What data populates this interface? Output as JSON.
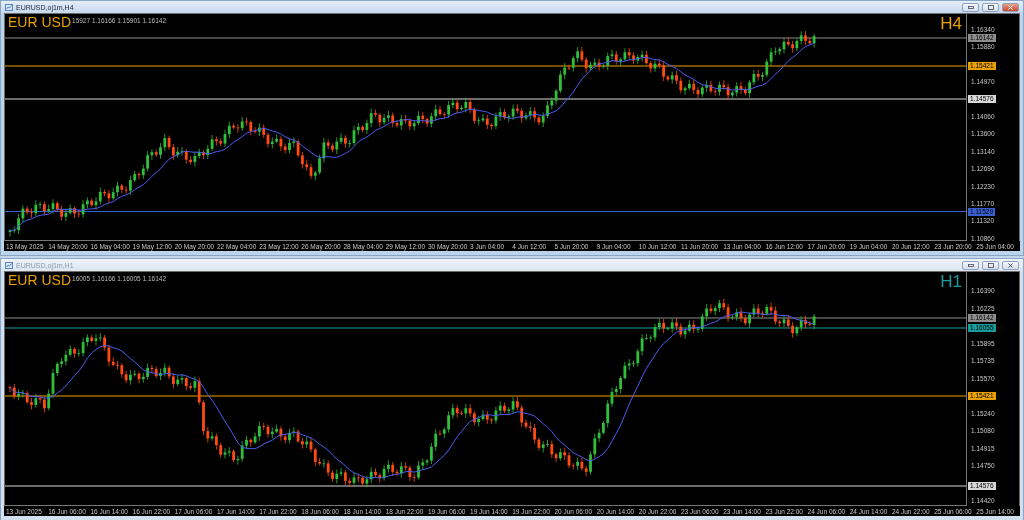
{
  "windows": [
    {
      "title": "EURUSD,oj1m,H4",
      "active": true,
      "symbol": "EUR USD",
      "ohlc": "15927 1.16166 1.15901 1.16142",
      "timeframe": {
        "label": "H4",
        "color": "#e8a000"
      },
      "price_ticks": [
        "1.16340",
        "1.15880",
        "1.14970",
        "1.14060",
        "1.13600",
        "1.13140",
        "1.12690",
        "1.12230",
        "1.11770",
        "1.11320",
        "1.10860"
      ],
      "lines": [
        {
          "price": "1.16142",
          "color": "#8c8c8c"
        },
        {
          "price": "1.15421",
          "color": "#e8a000"
        },
        {
          "price": "1.14576",
          "color": "#d8d8d8"
        },
        {
          "price": "1.11529",
          "color": "#3a5fd0"
        }
      ],
      "time_labels": [
        "13 May 2025",
        "14 May 20:00",
        "16 May 04:00",
        "19 May 12:00",
        "20 May 20:00",
        "22 May 04:00",
        "23 May 12:00",
        "26 May 20:00",
        "28 May 04:00",
        "29 May 12:00",
        "30 May 20:00",
        "3 Jun 04:00",
        "4 Jun 12:00",
        "5 Jun 20:00",
        "9 Jun 04:00",
        "10 Jun 12:00",
        "11 Jun 20:00",
        "13 Jun 04:00",
        "16 Jun 12:00",
        "17 Jun 20:00",
        "19 Jun 04:00",
        "20 Jun 12:00",
        "23 Jun 20:00",
        "25 Jun 04:00"
      ]
    },
    {
      "title": "EURUSD,oj1m,H1",
      "active": false,
      "symbol": "EUR USD",
      "ohlc": "16005 1.16166 1.16005 1.16142",
      "timeframe": {
        "label": "H1",
        "color": "#1a9c9c"
      },
      "price_ticks": [
        "1.16390",
        "1.16225",
        "1.15895",
        "1.15735",
        "1.15570",
        "1.15240",
        "1.15080",
        "1.14915",
        "1.14750",
        "1.14420"
      ],
      "lines": [
        {
          "price": "1.16142",
          "color": "#8c8c8c"
        },
        {
          "price": "1.16055",
          "color": "#1a9c9c"
        },
        {
          "price": "1.15421",
          "color": "#e8a000"
        },
        {
          "price": "1.14576",
          "color": "#d8d8d8"
        }
      ],
      "time_labels": [
        "13 Jun 2025",
        "16 Jun 06:00",
        "16 Jun 14:00",
        "16 Jun 22:00",
        "17 Jun 06:00",
        "17 Jun 14:00",
        "17 Jun 22:00",
        "18 Jun 06:00",
        "18 Jun 14:00",
        "18 Jun 22:00",
        "19 Jun 06:00",
        "19 Jun 14:00",
        "19 Jun 22:00",
        "20 Jun 06:00",
        "20 Jun 14:00",
        "20 Jun 22:00",
        "23 Jun 06:00",
        "23 Jun 14:00",
        "23 Jun 22:00",
        "24 Jun 06:00",
        "24 Jun 14:00",
        "24 Jun 22:00",
        "25 Jun 06:00",
        "25 Jun 14:00"
      ]
    }
  ]
}
